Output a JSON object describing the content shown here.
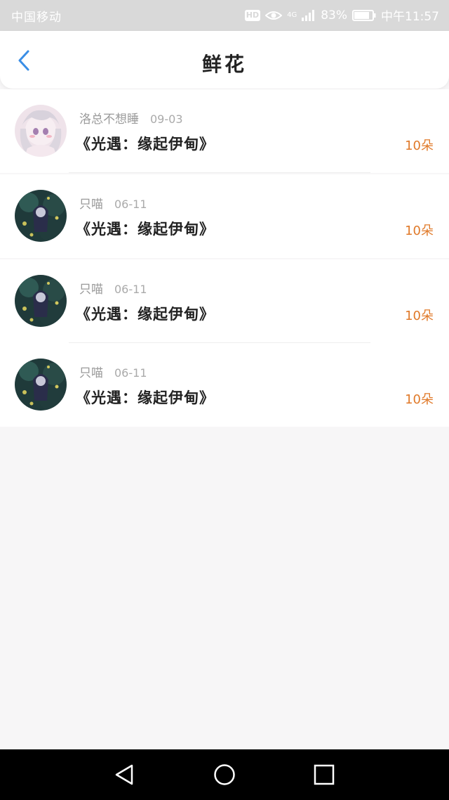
{
  "status_bar": {
    "carrier": "中国移动",
    "hd": "HD",
    "network": "4G",
    "battery_percent": "83%",
    "time": "中午11:57"
  },
  "nav": {
    "title": "鲜花"
  },
  "items": [
    {
      "user": "洛总不想睡",
      "date": "09-03",
      "title": "《光遇：缘起伊甸》",
      "count": "10朵"
    },
    {
      "user": "只喵",
      "date": "06-11",
      "title": "《光遇：缘起伊甸》",
      "count": "10朵"
    },
    {
      "user": "只喵",
      "date": "06-11",
      "title": "《光遇：缘起伊甸》",
      "count": "10朵"
    },
    {
      "user": "只喵",
      "date": "06-11",
      "title": "《光遇：缘起伊甸》",
      "count": "10朵"
    }
  ]
}
